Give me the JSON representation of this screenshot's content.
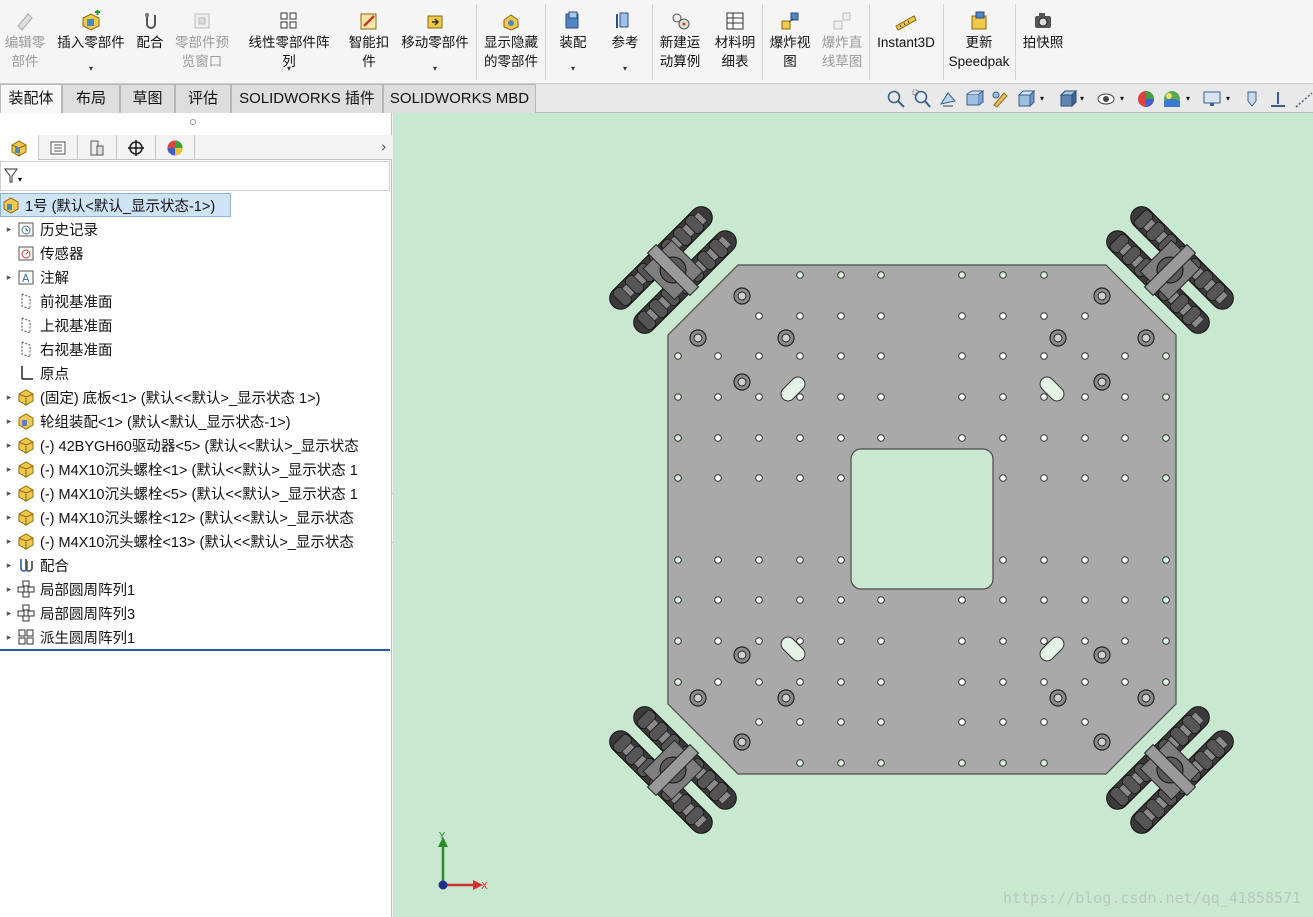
{
  "ribbon": {
    "buttons": [
      {
        "label": "编辑零\n部件",
        "icon": "edit-part-icon",
        "disabled": true,
        "dropdown": false
      },
      {
        "label": "插入零部件",
        "icon": "insert-component-icon",
        "disabled": false,
        "dropdown": true
      },
      {
        "label": "配合",
        "icon": "mate-icon",
        "disabled": false,
        "dropdown": false
      },
      {
        "label": "零部件预\n览窗口",
        "icon": "preview-window-icon",
        "disabled": true,
        "dropdown": false
      },
      {
        "label": "线性零部件阵列",
        "icon": "linear-pattern-icon",
        "disabled": false,
        "dropdown": true
      },
      {
        "label": "智能扣\n件",
        "icon": "smart-fastener-icon",
        "disabled": false,
        "dropdown": false
      },
      {
        "label": "移动零部件",
        "icon": "move-component-icon",
        "disabled": false,
        "dropdown": true
      },
      {
        "label": "显示隐藏\n的零部件",
        "icon": "show-hidden-icon",
        "disabled": false,
        "dropdown": false
      },
      {
        "label": "装配",
        "icon": "assembly-feature-icon",
        "disabled": false,
        "dropdown": true
      },
      {
        "label": "参考",
        "icon": "reference-geometry-icon",
        "disabled": false,
        "dropdown": true
      },
      {
        "label": "新建运\n动算例",
        "icon": "motion-study-icon",
        "disabled": false,
        "dropdown": false
      },
      {
        "label": "材料明\n细表",
        "icon": "bom-icon",
        "disabled": false,
        "dropdown": false
      },
      {
        "label": "爆炸视\n图",
        "icon": "exploded-view-icon",
        "disabled": false,
        "dropdown": false
      },
      {
        "label": "爆炸直\n线草图",
        "icon": "explode-line-icon",
        "disabled": true,
        "dropdown": false
      },
      {
        "label": "Instant3D",
        "icon": "instant3d-icon",
        "disabled": false,
        "dropdown": false
      },
      {
        "label": "更新\nSpeedpak",
        "icon": "speedpak-icon",
        "disabled": false,
        "dropdown": false
      },
      {
        "label": "拍快照",
        "icon": "snapshot-icon",
        "disabled": false,
        "dropdown": false
      }
    ]
  },
  "tabs": [
    "装配体",
    "布局",
    "草图",
    "评估",
    "SOLIDWORKS 插件",
    "SOLIDWORKS MBD"
  ],
  "tree": {
    "root": "1号  (默认<默认_显示状态-1>)",
    "items": [
      {
        "label": "历史记录",
        "expand": true,
        "icon": "history-icon"
      },
      {
        "label": "传感器",
        "expand": false,
        "icon": "sensor-icon"
      },
      {
        "label": "注解",
        "expand": true,
        "icon": "annotation-icon"
      },
      {
        "label": "前视基准面",
        "expand": false,
        "icon": "plane-icon"
      },
      {
        "label": "上视基准面",
        "expand": false,
        "icon": "plane-icon"
      },
      {
        "label": "右视基准面",
        "expand": false,
        "icon": "plane-icon"
      },
      {
        "label": "原点",
        "expand": false,
        "icon": "origin-icon"
      },
      {
        "label": "(固定) 底板<1> (默认<<默认>_显示状态 1>)",
        "expand": true,
        "icon": "part-icon"
      },
      {
        "label": "轮组装配<1> (默认<默认_显示状态-1>)",
        "expand": true,
        "icon": "subassembly-icon"
      },
      {
        "label": "(-) 42BYGH60驱动器<5> (默认<<默认>_显示状态",
        "expand": true,
        "icon": "part-icon"
      },
      {
        "label": "(-) M4X10沉头螺栓<1> (默认<<默认>_显示状态 1",
        "expand": true,
        "icon": "part-icon"
      },
      {
        "label": "(-) M4X10沉头螺栓<5> (默认<<默认>_显示状态 1",
        "expand": true,
        "icon": "part-icon"
      },
      {
        "label": "(-) M4X10沉头螺栓<12> (默认<<默认>_显示状态",
        "expand": true,
        "icon": "part-icon"
      },
      {
        "label": "(-) M4X10沉头螺栓<13> (默认<<默认>_显示状态",
        "expand": true,
        "icon": "part-icon"
      },
      {
        "label": "配合",
        "expand": true,
        "icon": "mates-folder-icon"
      },
      {
        "label": "局部圆周阵列1",
        "expand": true,
        "icon": "circular-pattern-icon"
      },
      {
        "label": "局部圆周阵列3",
        "expand": true,
        "icon": "circular-pattern-icon"
      },
      {
        "label": "派生圆周阵列1",
        "expand": true,
        "icon": "derived-pattern-icon"
      }
    ]
  },
  "triad": {
    "x_label": "X",
    "y_label": "Y"
  },
  "watermark": "https://blog.csdn.net/qq_41858571",
  "colors": {
    "viewport_bg": "#c8e8d0",
    "plate": "#a8a8a8",
    "selection": "#cfe3f7"
  }
}
